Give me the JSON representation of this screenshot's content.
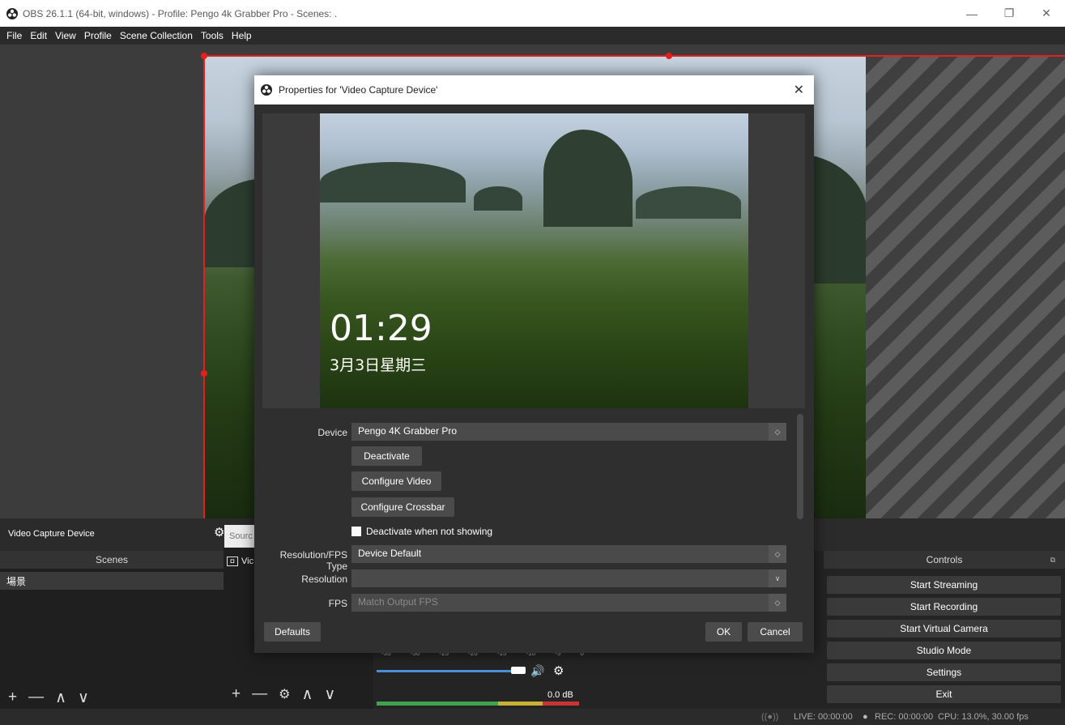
{
  "window": {
    "title": "OBS 26.1.1 (64-bit, windows) - Profile: Pengo 4k Grabber Pro - Scenes: .",
    "minimize": "—",
    "maximize": "❐",
    "close": "✕"
  },
  "menu": [
    "File",
    "Edit",
    "View",
    "Profile",
    "Scene Collection",
    "Tools",
    "Help"
  ],
  "current_source": "Video Capture Device",
  "sources_tab_label": "Sourc",
  "scenes": {
    "header": "Scenes",
    "items": [
      "場景"
    ],
    "toolbar": [
      "+",
      "—",
      "∧",
      "∨"
    ]
  },
  "sources": {
    "item_label": "Vic",
    "toolbar": [
      "+",
      "—",
      "⚙",
      "∧",
      "∨"
    ]
  },
  "mixer": {
    "ticks": [
      "-35",
      "-30",
      "-25",
      "-20",
      "-15",
      "-10",
      "-5",
      "0"
    ],
    "volume_db": "0.0 dB",
    "volume_level": 0.92
  },
  "controls": {
    "header": "Controls",
    "buttons": [
      "Start Streaming",
      "Start Recording",
      "Start Virtual Camera",
      "Studio Mode",
      "Settings",
      "Exit"
    ]
  },
  "status": {
    "live": "LIVE: 00:00:00",
    "rec": "REC: 00:00:00",
    "cpu": "CPU: 13.0%, 30.00 fps"
  },
  "dialog": {
    "title": "Properties for 'Video Capture Device'",
    "close": "✕",
    "preview": {
      "time": "01:29",
      "date": "3月3日星期三"
    },
    "device_label": "Device",
    "device_value": "Pengo 4K Grabber Pro",
    "buttons": {
      "deactivate": "Deactivate",
      "configure_video": "Configure Video",
      "configure_crossbar": "Configure Crossbar",
      "defaults": "Defaults",
      "ok": "OK",
      "cancel": "Cancel"
    },
    "checkbox_label": "Deactivate when not showing",
    "resolution_type_label": "Resolution/FPS Type",
    "resolution_type_value": "Device Default",
    "resolution_label": "Resolution",
    "resolution_value": "",
    "fps_label": "FPS",
    "fps_placeholder": "Match Output FPS"
  },
  "colors": {
    "selection": "#e81e1e",
    "volume_bar": "#4a90d9",
    "panel_bg": "#1f1f1f"
  }
}
